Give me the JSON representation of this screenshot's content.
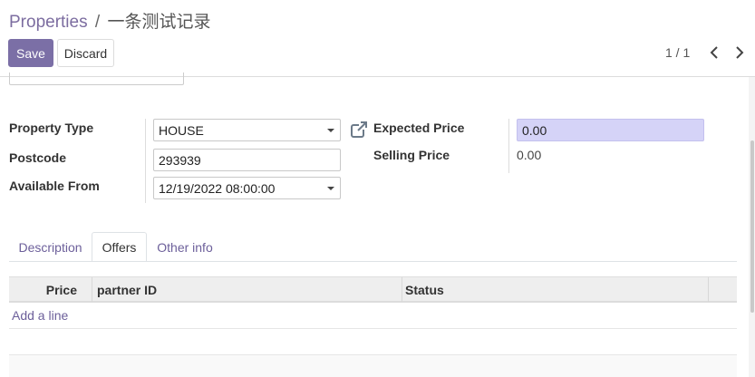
{
  "breadcrumb": {
    "parent": "Properties",
    "separator": "/",
    "current": "一条测试记录"
  },
  "toolbar": {
    "save_label": "Save",
    "discard_label": "Discard"
  },
  "pager": {
    "value": "1 / 1"
  },
  "form": {
    "property_type": {
      "label": "Property Type",
      "value": "HOUSE"
    },
    "postcode": {
      "label": "Postcode",
      "value": "293939"
    },
    "available_from": {
      "label": "Available From",
      "value": "12/19/2022 08:00:00"
    },
    "expected_price": {
      "label": "Expected Price",
      "value": "0.00"
    },
    "selling_price": {
      "label": "Selling Price",
      "value": "0.00"
    }
  },
  "tabs": [
    {
      "label": "Description",
      "active": false
    },
    {
      "label": "Offers",
      "active": true
    },
    {
      "label": "Other info",
      "active": false
    }
  ],
  "offers_table": {
    "columns": [
      "Price",
      "partner ID",
      "Status"
    ],
    "add_line_label": "Add a line"
  },
  "icons": {
    "external_link": "external-link-icon",
    "prev": "chevron-left-icon",
    "next": "chevron-right-icon",
    "dropdown": "caret-down-icon"
  },
  "colors": {
    "brand": "#7b6fa6",
    "link": "#6c5f9a",
    "price_field_bg": "#d5d3f7"
  }
}
